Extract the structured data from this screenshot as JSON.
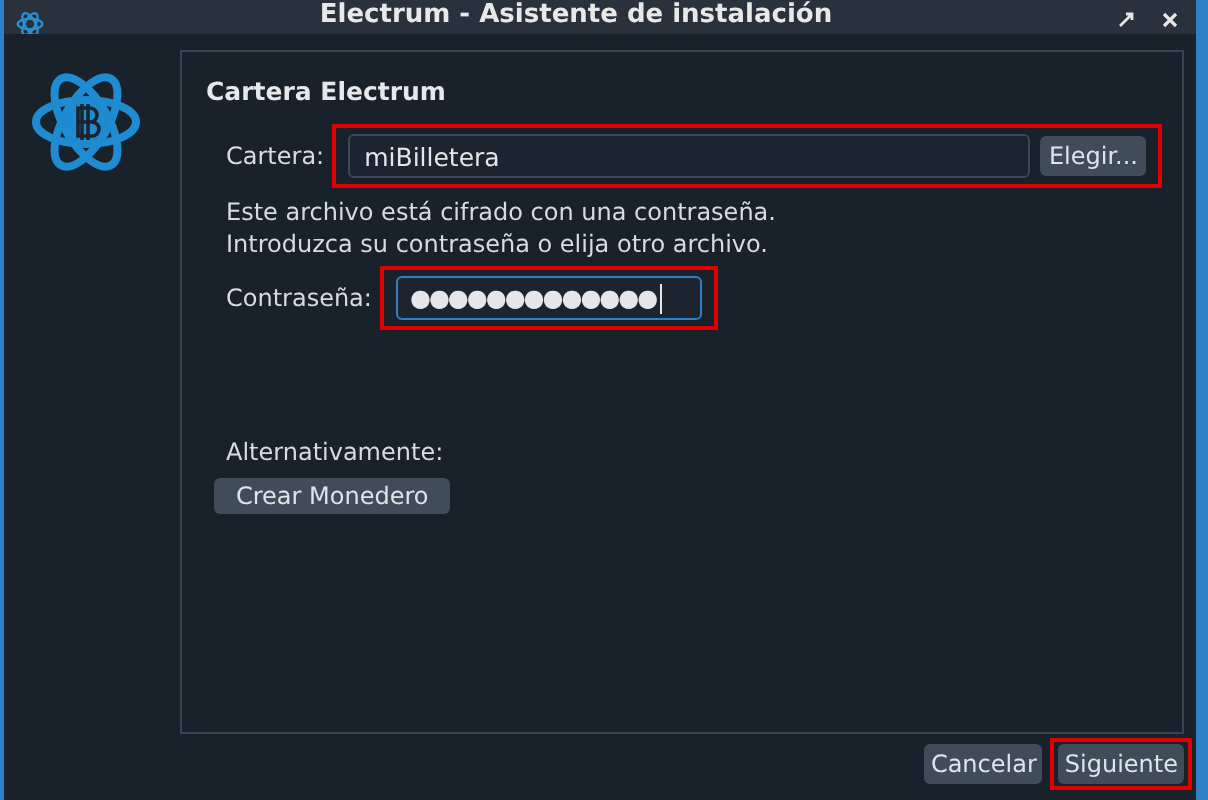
{
  "window": {
    "title": "Electrum  -  Asistente de instalación"
  },
  "panel": {
    "title": "Cartera Electrum",
    "wallet": {
      "label": "Cartera:",
      "value": "miBilletera",
      "button": "Elegir...",
      "highlighted": true
    },
    "message": [
      "Este archivo está cifrado con una contraseña.",
      "Introduzca su contraseña o elija otro archivo."
    ],
    "password": {
      "label": "Contraseña:",
      "value": "●●●●●●●●●●●●●",
      "focused": true,
      "highlighted": true
    },
    "alternative": {
      "label": "Alternativamente:",
      "button": "Crear Monedero"
    }
  },
  "buttons": [
    {
      "label": "Cancelar",
      "highlighted": false
    },
    {
      "label": "Siguiente",
      "highlighted": true
    }
  ]
}
